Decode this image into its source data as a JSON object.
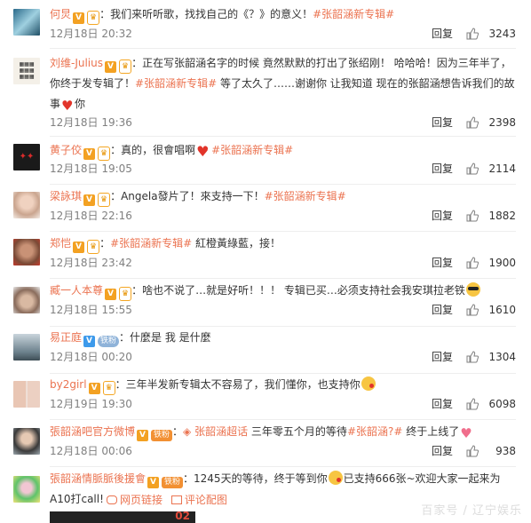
{
  "ui": {
    "reply_label": "回复",
    "topic_tag": "#张韶涵新专辑#",
    "links": {
      "web_link": "网页链接",
      "comment_image": "评论配图"
    },
    "watermark": "百家号 / 辽宁娱乐",
    "image_strip_text": "02"
  },
  "comments": [
    {
      "user": "何炅",
      "badges": [
        "V",
        "vip"
      ],
      "pre": "：我们来听听歌，找找自己的《？》的意义！",
      "topic": "#张韶涵新专辑#",
      "post": "",
      "time": "12月18日 20:32",
      "likes": "3243"
    },
    {
      "user": "刘维-Julius",
      "badges": [
        "V",
        "vip"
      ],
      "pre": "：正在写张韶涵名字的时候 竟然默默的打出了张绍刚！ 哈哈哈！因为三年半了，你终于发专辑了！",
      "topic": "#张韶涵新专辑#",
      "post": " 等了太久了……谢谢你 让我知道 现在的张韶涵想告诉我们的故事",
      "post2": "你",
      "time": "12月18日 19:36",
      "likes": "2398"
    },
    {
      "user": "黄子佼",
      "badges": [
        "V",
        "vip"
      ],
      "pre": "：真的，很會唱啊",
      "topic": "#张韶涵新专辑#",
      "post": "",
      "time": "12月18日 19:05",
      "likes": "2114"
    },
    {
      "user": "梁詠琪",
      "badges": [
        "V",
        "vip"
      ],
      "pre": "：Angela發片了！來支持一下！",
      "topic": "#张韶涵新专辑#",
      "post": "",
      "time": "12月18日 22:16",
      "likes": "1882"
    },
    {
      "user": "郑恺",
      "badges": [
        "V",
        "vip"
      ],
      "pre": "：",
      "topic": "#张韶涵新专辑#",
      "post": " 紅橙黃綠藍，接！",
      "time": "12月18日 23:42",
      "likes": "1900"
    },
    {
      "user": "臧一人本尊",
      "badges": [
        "V",
        "vip"
      ],
      "pre": "：啥也不说了…就是好听！！！ 专辑已买…必须支持社会我安琪拉老铁",
      "topic": "",
      "post": "",
      "time": "12月18日 15:55",
      "likes": "1610"
    },
    {
      "user": "易正庭",
      "badges": [
        "V",
        "fan"
      ],
      "fan_label": "铁粉",
      "pre": "：什麼是 我 是什麼",
      "topic": "",
      "post": "",
      "time": "12月18日 00:20",
      "likes": "1304"
    },
    {
      "user": "by2girl",
      "badges": [
        "V",
        "vip"
      ],
      "pre": "：三年半发新专辑太不容易了，我们懂你，也支持你",
      "topic": "",
      "post": "",
      "time": "12月19日 19:30",
      "likes": "6098"
    },
    {
      "user": "張韶涵吧官方微博",
      "badges": [
        "V",
        "iron"
      ],
      "iron_label": "铁粉",
      "pre": "：",
      "super_topic": "张韶涵超话",
      "mid": " 三年零五个月的等待",
      "topic": "#张韶涵?#",
      "post": " 终于上线了",
      "time": "12月18日 00:06",
      "likes": "938"
    },
    {
      "user": "張韶涵情脈脈後援會",
      "badges": [
        "V",
        "iron"
      ],
      "iron_label": "铁粉",
      "pre": "：1245天的等待，终于等到你",
      "post": "已支持666张~欢迎大家一起来为A10打call!",
      "topic": "",
      "time": "",
      "likes": ""
    }
  ],
  "colors": {
    "accent": "#eb7350",
    "meta": "#808080",
    "verified": "#f3a122"
  }
}
